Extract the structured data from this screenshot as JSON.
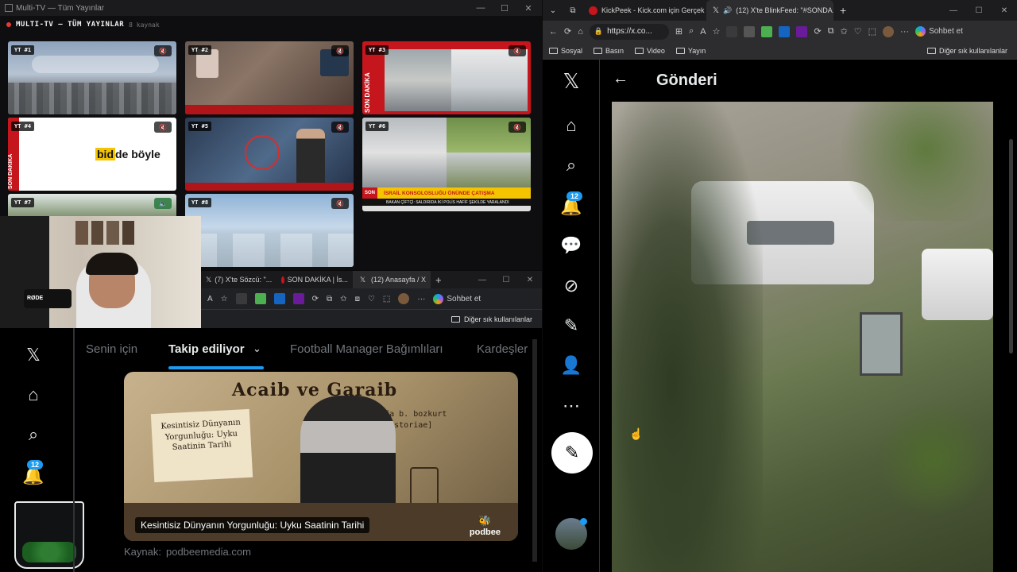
{
  "multitv": {
    "window_title": "Multi-TV — Tüm Yayınlar",
    "header_title": "MULTI-TV — TÜM YAYINLAR",
    "header_count": "8 kaynak",
    "tiles": [
      {
        "label": "YT #1"
      },
      {
        "label": "YT #2"
      },
      {
        "label": "YT #3"
      },
      {
        "label": "YT #4"
      },
      {
        "label": "YT #5"
      },
      {
        "label": "YT #6"
      },
      {
        "label": "YT #7"
      },
      {
        "label": "YT #8"
      }
    ],
    "tile4_logo_a": "bid",
    "tile4_logo_b": "de böyle",
    "son_dakika": "SON DAKİKA",
    "tile6_banner": "İSRAİL KONSOLOSLUĞU ÖNÜNDE ÇATIŞMA",
    "tile6_sub": "BAKAN ÇİFTÇİ: SALDIRIDA İKİ POLİS HAFİF ŞEKİLDE YARALANDI"
  },
  "browser2": {
    "tabs": [
      {
        "label": "(7) X'te Sözcü: \"..."
      },
      {
        "label": "SON DAKİKA | İs..."
      },
      {
        "label": "(12) Anasayfa / X"
      }
    ],
    "chat_label": "Sohbet et",
    "bookmarks_other": "Diğer sık kullanılanlar"
  },
  "xleft": {
    "tabs": [
      "Senin için",
      "Takip ediliyor",
      "Football Manager Bağımlıları",
      "Kardeşler"
    ],
    "notif_count": "12",
    "card_title_big": "Acaib ve Garaib",
    "card_author": "mustafa b. bozkurt",
    "card_author_sub": "[lex historiae]",
    "card_paper_text": "Kesintisiz Dünyanın Yorgunluğu: Uyku Saatinin Tarihi",
    "card_caption": "Kesintisiz Dünyanın Yorgunluğu: Uyku Saatinin Tarihi",
    "card_brand": "podbee",
    "source_label": "Kaynak:",
    "source_value": "podbeemedia.com"
  },
  "browser1": {
    "tabs": [
      {
        "label": "KickPeek - Kick.com için Gerçek Za..."
      },
      {
        "label": "(12) X'te BlinkFeed: \"#SONDA..."
      }
    ],
    "url": "https://x.co...",
    "chat_label": "Sohbet et",
    "bookmarks": [
      "Sosyal",
      "Basın",
      "Video",
      "Yayın"
    ],
    "bookmarks_other": "Diğer sık kullanılanlar",
    "page_title": "Gönderi",
    "notif_count": "12"
  },
  "colors": {
    "accent": "#1d9bf0",
    "breaking_red": "#c4161c"
  }
}
